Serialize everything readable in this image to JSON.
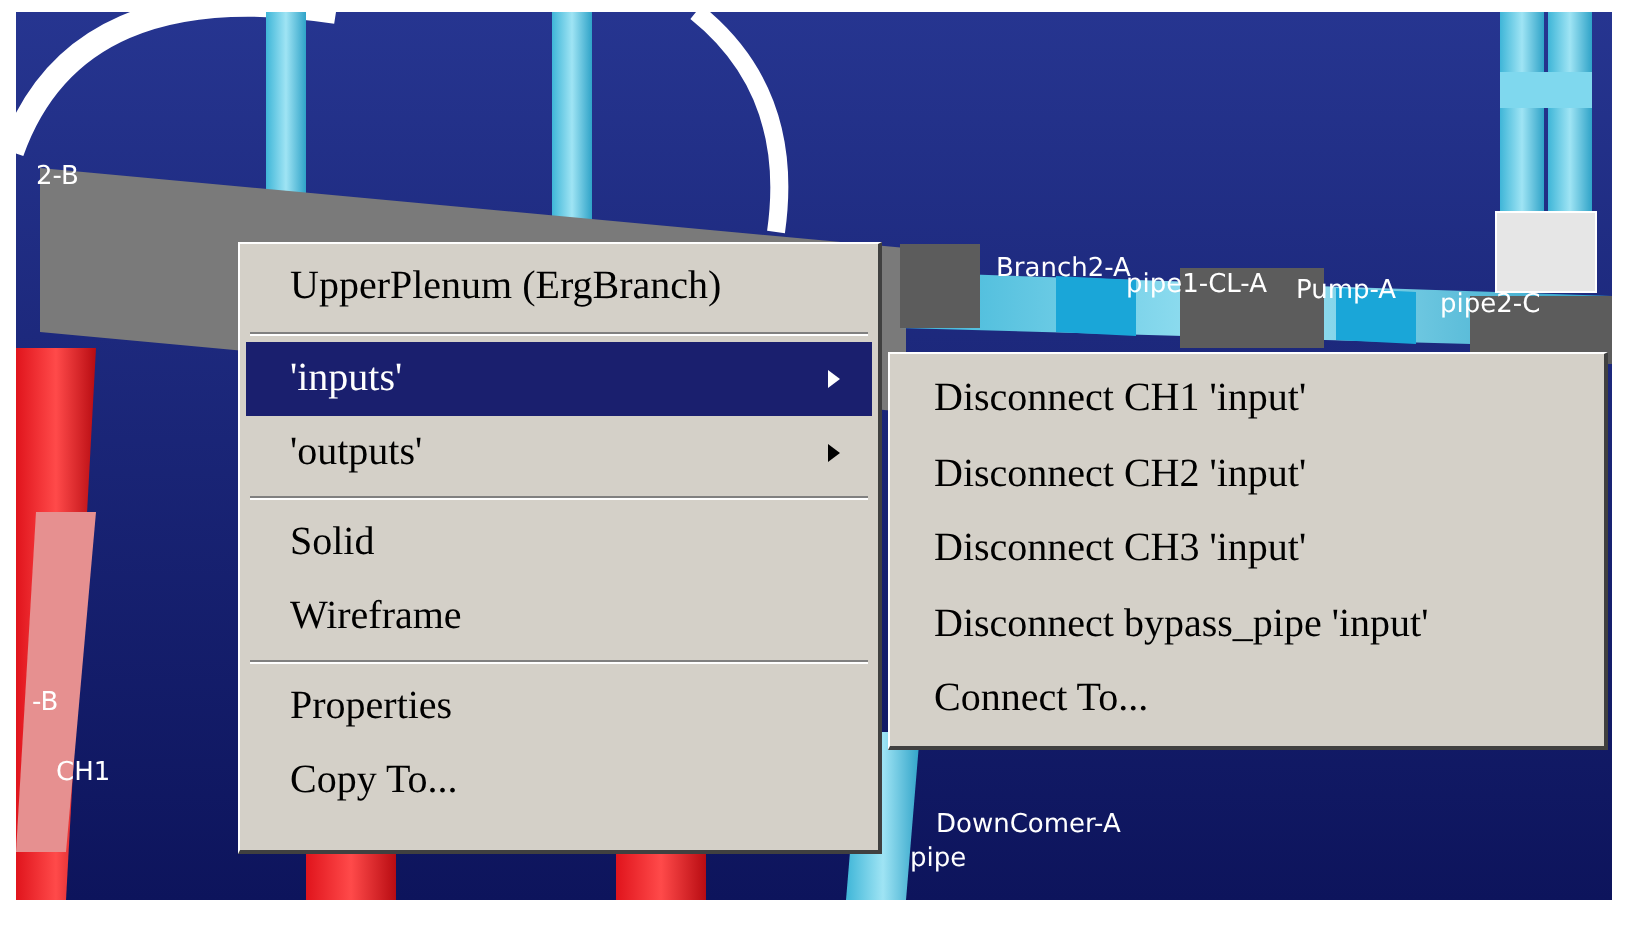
{
  "scene_labels": [
    {
      "text": "2-B"
    },
    {
      "text": "Branch2-A"
    },
    {
      "text": "pipe1-CL-A"
    },
    {
      "text": "Pump-A"
    },
    {
      "text": "pipe2-C"
    },
    {
      "text": "-B"
    },
    {
      "text": "CH1"
    },
    {
      "text": "DownComer-A"
    },
    {
      "text": "pipe"
    }
  ],
  "context_menu": {
    "items": [
      {
        "kind": "title",
        "label": "UpperPlenum (ErgBranch)"
      },
      {
        "kind": "separator"
      },
      {
        "kind": "item",
        "label": "'inputs'",
        "has_submenu": true,
        "selected": true
      },
      {
        "kind": "item",
        "label": "'outputs'",
        "has_submenu": true,
        "selected": false
      },
      {
        "kind": "separator"
      },
      {
        "kind": "item",
        "label": "Solid",
        "has_submenu": false,
        "selected": false
      },
      {
        "kind": "item",
        "label": "Wireframe",
        "has_submenu": false,
        "selected": false
      },
      {
        "kind": "separator"
      },
      {
        "kind": "item",
        "label": "Properties",
        "has_submenu": false,
        "selected": false
      },
      {
        "kind": "item",
        "label": "Copy To...",
        "has_submenu": false,
        "selected": false
      }
    ]
  },
  "submenu": {
    "items": [
      {
        "label": "Disconnect CH1 'input'"
      },
      {
        "label": "Disconnect CH2 'input'"
      },
      {
        "label": "Disconnect CH3 'input'"
      },
      {
        "label": "Disconnect bypass_pipe 'input'"
      },
      {
        "label": "Connect To..."
      }
    ]
  }
}
